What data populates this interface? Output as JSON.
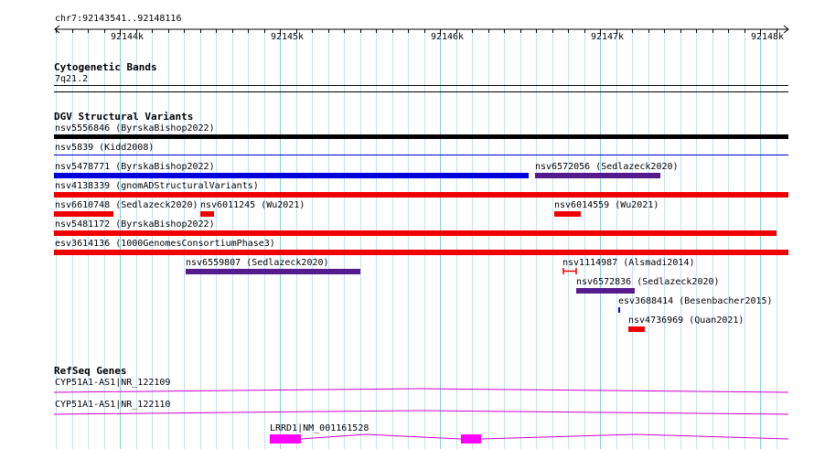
{
  "region": "chr7:92143541..92148116",
  "ruler": {
    "major_ticks": [
      "92144k",
      "92145k",
      "92146k",
      "92147k",
      "92148k"
    ]
  },
  "cytoband": {
    "title": "Cytogenetic Bands",
    "band": "7q21.2"
  },
  "dgv": {
    "title": "DGV Structural Variants",
    "features": [
      {
        "id": "f0",
        "label": "nsv5556846 (ByrskaBishop2022)",
        "color": "#000000"
      },
      {
        "id": "f1",
        "label": "nsv5839 (Kidd2008)",
        "color": "#0000cc"
      },
      {
        "id": "f2",
        "label": "nsv5478771 (ByrskaBishop2022)",
        "color": "#0000dd"
      },
      {
        "id": "f3",
        "label": "nsv6572056 (Sedlazeck2020)",
        "color": "#551a8b"
      },
      {
        "id": "f4",
        "label": "nsv4138339 (gnomADStructuralVariants)",
        "color": "#ee0000"
      },
      {
        "id": "f5",
        "label": "nsv6610748 (Sedlazeck2020)",
        "color": "#ee0000"
      },
      {
        "id": "f6",
        "label": "nsv6011245 (Wu2021)",
        "color": "#ee0000"
      },
      {
        "id": "f7",
        "label": "nsv6014559 (Wu2021)",
        "color": "#ee0000"
      },
      {
        "id": "f8",
        "label": "nsv5481172 (ByrskaBishop2022)",
        "color": "#ee0000"
      },
      {
        "id": "f9",
        "label": "esv3614136 (1000GenomesConsortiumPhase3)",
        "color": "#ee0000"
      },
      {
        "id": "f10",
        "label": "nsv6559807 (Sedlazeck2020)",
        "color": "#551a8b"
      },
      {
        "id": "f11",
        "label": "nsv1114987 (Alsmadi2014)",
        "color": "#ee0000"
      },
      {
        "id": "f12",
        "label": "nsv6572836 (Sedlazeck2020)",
        "color": "#551a8b"
      },
      {
        "id": "f13",
        "label": "esv3688414 (Besenbacher2015)",
        "color": "#0000dd"
      },
      {
        "id": "f14",
        "label": "nsv4736969 (Quan2021)",
        "color": "#ee0000"
      }
    ]
  },
  "refseq": {
    "title": "RefSeq Genes",
    "genes": [
      {
        "label": "CYP51A1-AS1|NR_122109",
        "color": "#cc00cc"
      },
      {
        "label": "CYP51A1-AS1|NR_122110",
        "color": "#cc00cc"
      },
      {
        "label": "LRRD1|NM_001161528",
        "color": "#ff00ff"
      }
    ]
  }
}
